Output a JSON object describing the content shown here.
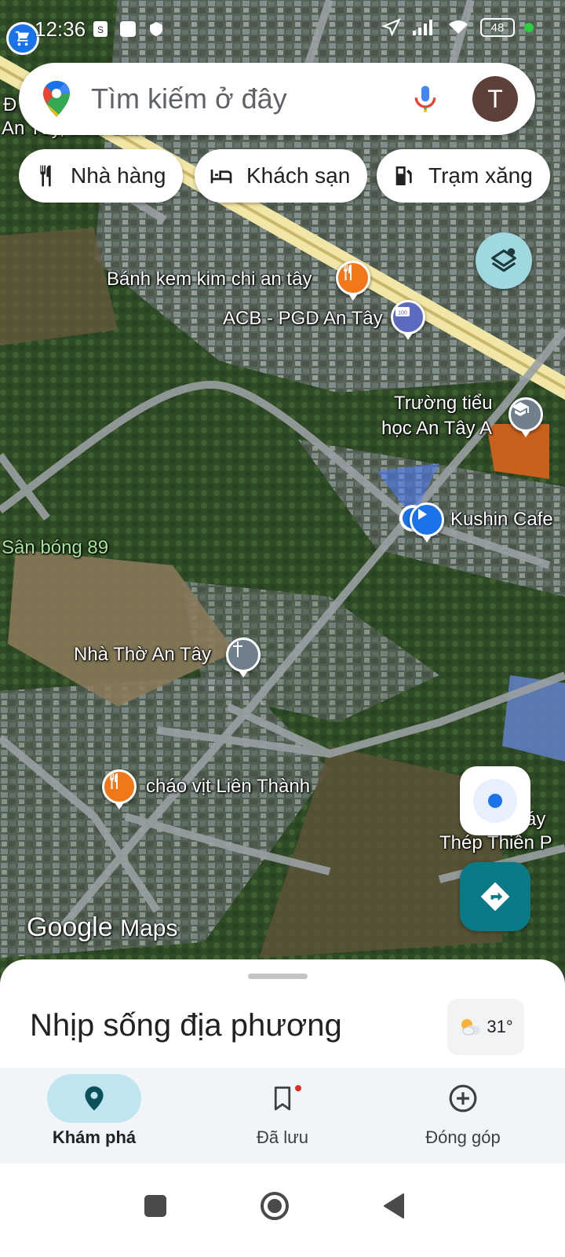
{
  "status_bar": {
    "time": "12:36",
    "battery": "48"
  },
  "search": {
    "placeholder": "Tìm kiếm ở đây",
    "avatar_letter": "T"
  },
  "chips": [
    {
      "label": "Nhà hàng",
      "icon": "fork-knife-icon"
    },
    {
      "label": "Khách sạn",
      "icon": "bed-icon"
    },
    {
      "label": "Trạm xăng",
      "icon": "gas-station-icon"
    }
  ],
  "map": {
    "labels": {
      "corner_top": "Đ",
      "corner_sub": "An Tây, Bến Cát",
      "bakery": "Bánh kem kim chi an tây",
      "bank": "ACB - PGD An Tây",
      "school_line1": "Trường tiểu",
      "school_line2": "học An Tây A",
      "cafe": "Kushin Cafe",
      "field": "Sân bóng 89",
      "church": "Nhà Thờ An Tây",
      "porridge": "cháo vịt Liên Thành",
      "factory_line1": "áy",
      "factory_line2": "Thép Thiên P"
    },
    "logo_google": "Google",
    "logo_maps": "Maps"
  },
  "bottom_sheet": {
    "title": "Nhịp sống địa phương",
    "temperature": "31°"
  },
  "bottom_nav": [
    {
      "label": "Khám phá",
      "icon": "location-pin-icon",
      "active": true
    },
    {
      "label": "Đã lưu",
      "icon": "bookmark-icon",
      "active": false
    },
    {
      "label": "Đóng góp",
      "icon": "add-circle-icon",
      "active": false
    }
  ],
  "colors": {
    "accent": "#1a73e8",
    "active_pill": "#bfe5ee",
    "directions_fab": "#0b7a87",
    "food_pin": "#f0771a"
  }
}
